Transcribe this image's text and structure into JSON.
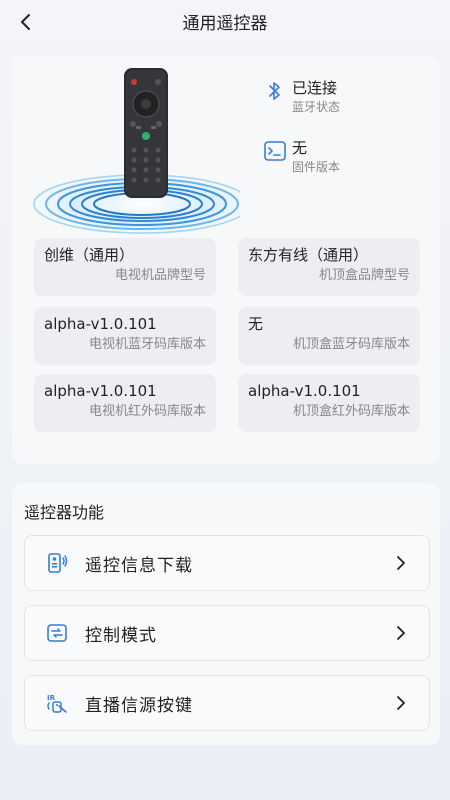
{
  "header": {
    "title": "通用遥控器"
  },
  "status": {
    "bluetooth": {
      "value": "已连接",
      "label": "蓝牙状态"
    },
    "firmware": {
      "value": "无",
      "label": "固件版本"
    }
  },
  "info_tiles": [
    {
      "value": "创维（通用）",
      "label": "电视机品牌型号"
    },
    {
      "value": "东方有线（通用）",
      "label": "机顶盒品牌型号"
    },
    {
      "value": "alpha-v1.0.101",
      "label": "电视机蓝牙码库版本"
    },
    {
      "value": "无",
      "label": "机顶盒蓝牙码库版本"
    },
    {
      "value": "alpha-v1.0.101",
      "label": "电视机红外码库版本"
    },
    {
      "value": "alpha-v1.0.101",
      "label": "机顶盒红外码库版本"
    }
  ],
  "functions": {
    "title": "遥控器功能",
    "items": [
      {
        "label": "遥控信息下载",
        "icon": "remote-download-icon"
      },
      {
        "label": "控制模式",
        "icon": "control-mode-icon"
      },
      {
        "label": "直播信源按键",
        "icon": "ir-source-icon"
      }
    ]
  },
  "colors": {
    "accent": "#3a7bd5",
    "ring": "#4aa8e8"
  }
}
